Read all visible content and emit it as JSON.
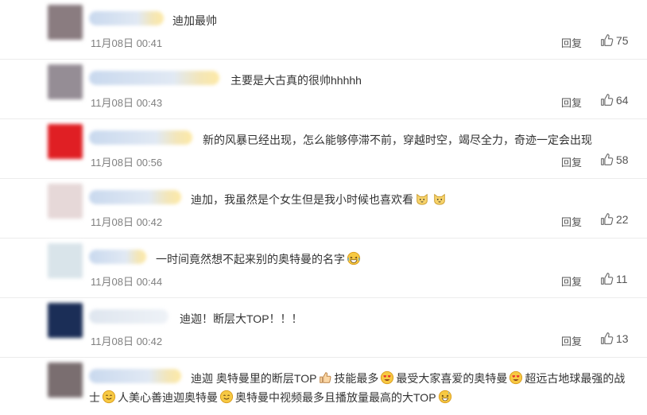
{
  "reply_label": "回复",
  "comments": [
    {
      "text": "迪加最帅",
      "time": "11月08日 00:41",
      "likes": "75",
      "avatar_color": "#8a7c80"
    },
    {
      "text": "主要是大古真的很帅hhhhh",
      "time": "11月08日 00:43",
      "likes": "64",
      "avatar_color": "#958d95"
    },
    {
      "text": "新的风暴已经出现，怎么能够停滞不前，穿越时空，竭尽全力，奇迹一定会出现",
      "time": "11月08日 00:56",
      "likes": "58",
      "avatar_color": "#e01f24"
    },
    {
      "text": "迪加，我虽然是个女生但是我小时候也喜欢看",
      "time": "11月08日 00:42",
      "likes": "22",
      "avatar_color": "#e6d8d8"
    },
    {
      "text": "一时间竟然想不起来别的奥特曼的名字",
      "time": "11月08日 00:44",
      "likes": "11",
      "avatar_color": "#d9e4ea"
    },
    {
      "text": "迪迦！断层大TOP！！！",
      "time": "11月08日 00:42",
      "likes": "13",
      "avatar_color": "#1b2e57"
    },
    {
      "line1_parts": [
        "迪迦 奥特曼里的断层TOP",
        "技能最多",
        "最受大家喜爱的奥特曼",
        "超远古地球最强的战"
      ],
      "line2_parts": [
        "士",
        "人美心善迪迦奥特曼",
        "奥特曼中视频最多且播放量最高的大TOP"
      ],
      "avatar_color": "#7a6e70"
    }
  ],
  "icons": [
    "thumbs-up-icon",
    "cat-face-icon",
    "laughing-tears-icon",
    "thumbs-up-emoji-icon",
    "heart-eyes-icon",
    "smiling-face-icon",
    "sweat-smile-icon"
  ],
  "colors": {
    "time_text": "#808080",
    "body_text": "#333333",
    "divider": "#ececec"
  }
}
